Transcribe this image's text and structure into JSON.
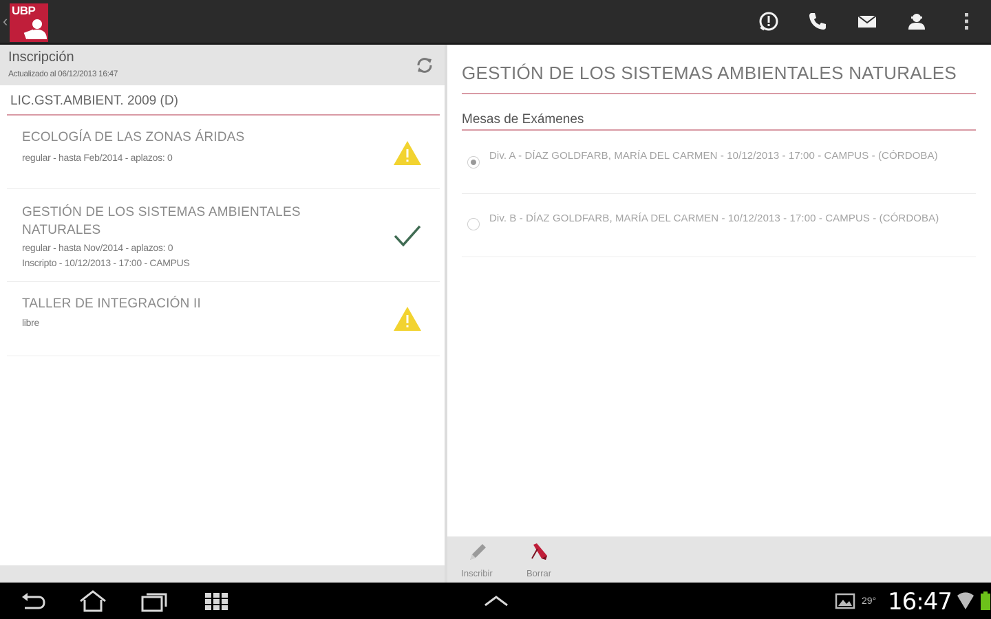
{
  "app": {
    "logo_text": "UBP",
    "brand_color": "#c01e3a"
  },
  "actionbar": {
    "icons": [
      "clock-alert-icon",
      "phone-icon",
      "mail-icon",
      "user-icon",
      "overflow-menu-icon"
    ]
  },
  "left": {
    "header_title": "Inscripción",
    "header_subtitle": "Actualizado al 06/12/2013 16:47",
    "career": "LIC.GST.AMBIENT. 2009 (D)",
    "courses": [
      {
        "name": "ECOLOGÍA DE LAS ZONAS ÁRIDAS",
        "meta": [
          "regular - hasta Feb/2014 - aplazos: 0"
        ],
        "status": "warning"
      },
      {
        "name": "GESTIÓN DE LOS SISTEMAS AMBIENTALES NATURALES",
        "meta": [
          "regular - hasta Nov/2014 - aplazos: 0",
          "Inscripto - 10/12/2013 - 17:00 - CAMPUS"
        ],
        "status": "check"
      },
      {
        "name": "TALLER DE INTEGRACIÓN II",
        "meta": [
          "libre"
        ],
        "status": "warning"
      }
    ]
  },
  "right": {
    "title": "GESTIÓN DE LOS SISTEMAS AMBIENTALES NATURALES",
    "section_title": "Mesas de Exámenes",
    "options": [
      {
        "text": "Div. A - DÍAZ GOLDFARB, MARÍA DEL CARMEN - 10/12/2013 - 17:00 - CAMPUS - (CÓRDOBA)",
        "selected": true
      },
      {
        "text": "Div. B - DÍAZ GOLDFARB, MARÍA DEL CARMEN - 10/12/2013 - 17:00 - CAMPUS - (CÓRDOBA)",
        "selected": false
      }
    ],
    "buttons": {
      "inscribir": "Inscribir",
      "borrar": "Borrar"
    }
  },
  "system": {
    "temperature": "29°",
    "clock": "16:47"
  },
  "colors": {
    "warning": "#f2d330",
    "check": "#3f6b52",
    "accent_line": "#d99aa5"
  }
}
